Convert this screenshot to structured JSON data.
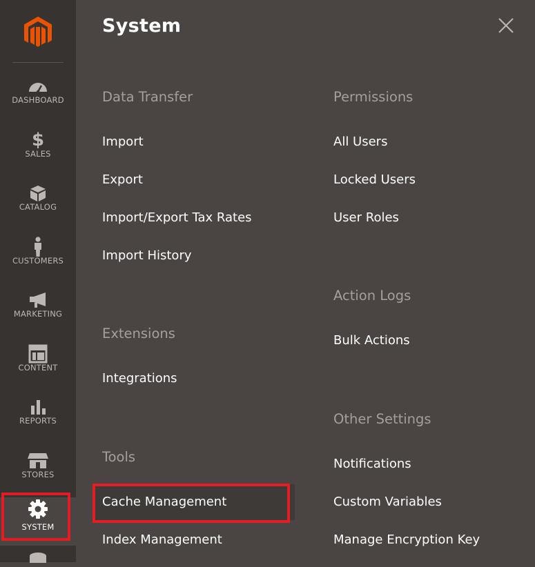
{
  "sidebar": {
    "items": [
      {
        "id": "dashboard",
        "label": "DASHBOARD",
        "icon": "dashboard-icon"
      },
      {
        "id": "sales",
        "label": "SALES",
        "icon": "dollar-icon"
      },
      {
        "id": "catalog",
        "label": "CATALOG",
        "icon": "box-icon"
      },
      {
        "id": "customers",
        "label": "CUSTOMERS",
        "icon": "person-icon"
      },
      {
        "id": "marketing",
        "label": "MARKETING",
        "icon": "megaphone-icon"
      },
      {
        "id": "content",
        "label": "CONTENT",
        "icon": "layout-icon"
      },
      {
        "id": "reports",
        "label": "REPORTS",
        "icon": "bar-chart-icon"
      },
      {
        "id": "stores",
        "label": "STORES",
        "icon": "storefront-icon"
      },
      {
        "id": "system",
        "label": "SYSTEM",
        "icon": "gear-icon",
        "active": true
      }
    ]
  },
  "panel": {
    "title": "System",
    "close_icon": "close-icon",
    "left_column": {
      "data_transfer": {
        "heading": "Data Transfer",
        "links": [
          "Import",
          "Export",
          "Import/Export Tax Rates",
          "Import History"
        ]
      },
      "extensions": {
        "heading": "Extensions",
        "links": [
          "Integrations"
        ]
      },
      "tools": {
        "heading": "Tools",
        "links": [
          "Cache Management",
          "Index Management"
        ]
      }
    },
    "right_column": {
      "permissions": {
        "heading": "Permissions",
        "links": [
          "All Users",
          "Locked Users",
          "User Roles"
        ]
      },
      "action_logs": {
        "heading": "Action Logs",
        "links": [
          "Bulk Actions"
        ]
      },
      "other_settings": {
        "heading": "Other Settings",
        "links": [
          "Notifications",
          "Custom Variables",
          "Manage Encryption Key"
        ]
      }
    }
  },
  "colors": {
    "sidebar_bg": "#373330",
    "panel_bg": "#4a4542",
    "brand_orange": "#eb5202",
    "highlight_red": "#e41c24"
  }
}
